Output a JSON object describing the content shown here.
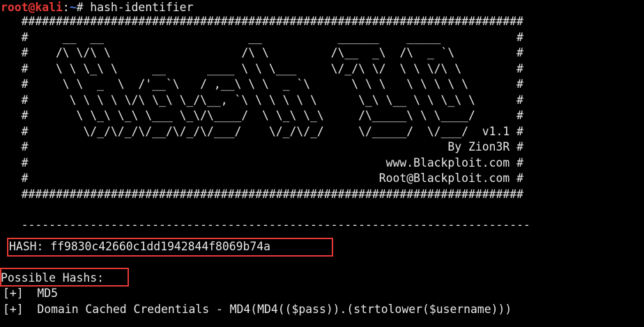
{
  "prompt": {
    "user_host": "root@kali",
    "separator": ":",
    "path": "~",
    "symbol": "#",
    "command": " hash-identifier"
  },
  "banner": {
    "lines": [
      "   #########################################################################",
      "   #     __  __                     __           ______    _____           #",
      "   #    /\\ \\/\\ \\                   /\\ \\         /\\__  _\\  /\\  _ `\\         #",
      "   #    \\ \\ \\_\\ \\     __      ____ \\ \\ \\___     \\/_/\\ \\/  \\ \\ \\/\\ \\        #",
      "   #     \\ \\  _  \\  /'__`\\   / ,__\\ \\ \\  _ `\\      \\ \\ \\   \\ \\ \\ \\ \\       #",
      "   #      \\ \\ \\ \\ \\/\\ \\_\\ \\_/\\__, `\\ \\ \\ \\ \\ \\      \\_\\ \\__ \\ \\ \\_\\ \\      #",
      "   #       \\ \\_\\ \\_\\ \\___ \\_\\/\\____/  \\ \\_\\ \\_\\     /\\_____\\ \\ \\____/      #",
      "   #        \\/_/\\/_/\\/__/\\/_/\\/___/    \\/_/\\/_/     \\/_____/  \\/___/  v1.1 #",
      "   #                                                             By Zion3R #",
      "   #                                                    www.Blackploit.com #",
      "   #                                                   Root@Blackploit.com #",
      "   #########################################################################"
    ]
  },
  "separator_line": "   --------------------------------------------------------------------------",
  "hash": {
    "label": "HASH:",
    "value": "ff9830c42660c1dd1942844f8069b74a"
  },
  "results": {
    "heading": "Possible Hashs:",
    "items": [
      {
        "marker": "[+]",
        "name": "MD5"
      },
      {
        "marker": "[+]",
        "name": "Domain Cached Credentials - MD4(MD4(($pass)).(strtolower($username)))"
      }
    ]
  },
  "colors": {
    "background": "#000000",
    "text": "#e8e8e8",
    "prompt_user": "#e53935",
    "prompt_path": "#4a78d8",
    "highlight_border": "#e53935"
  }
}
